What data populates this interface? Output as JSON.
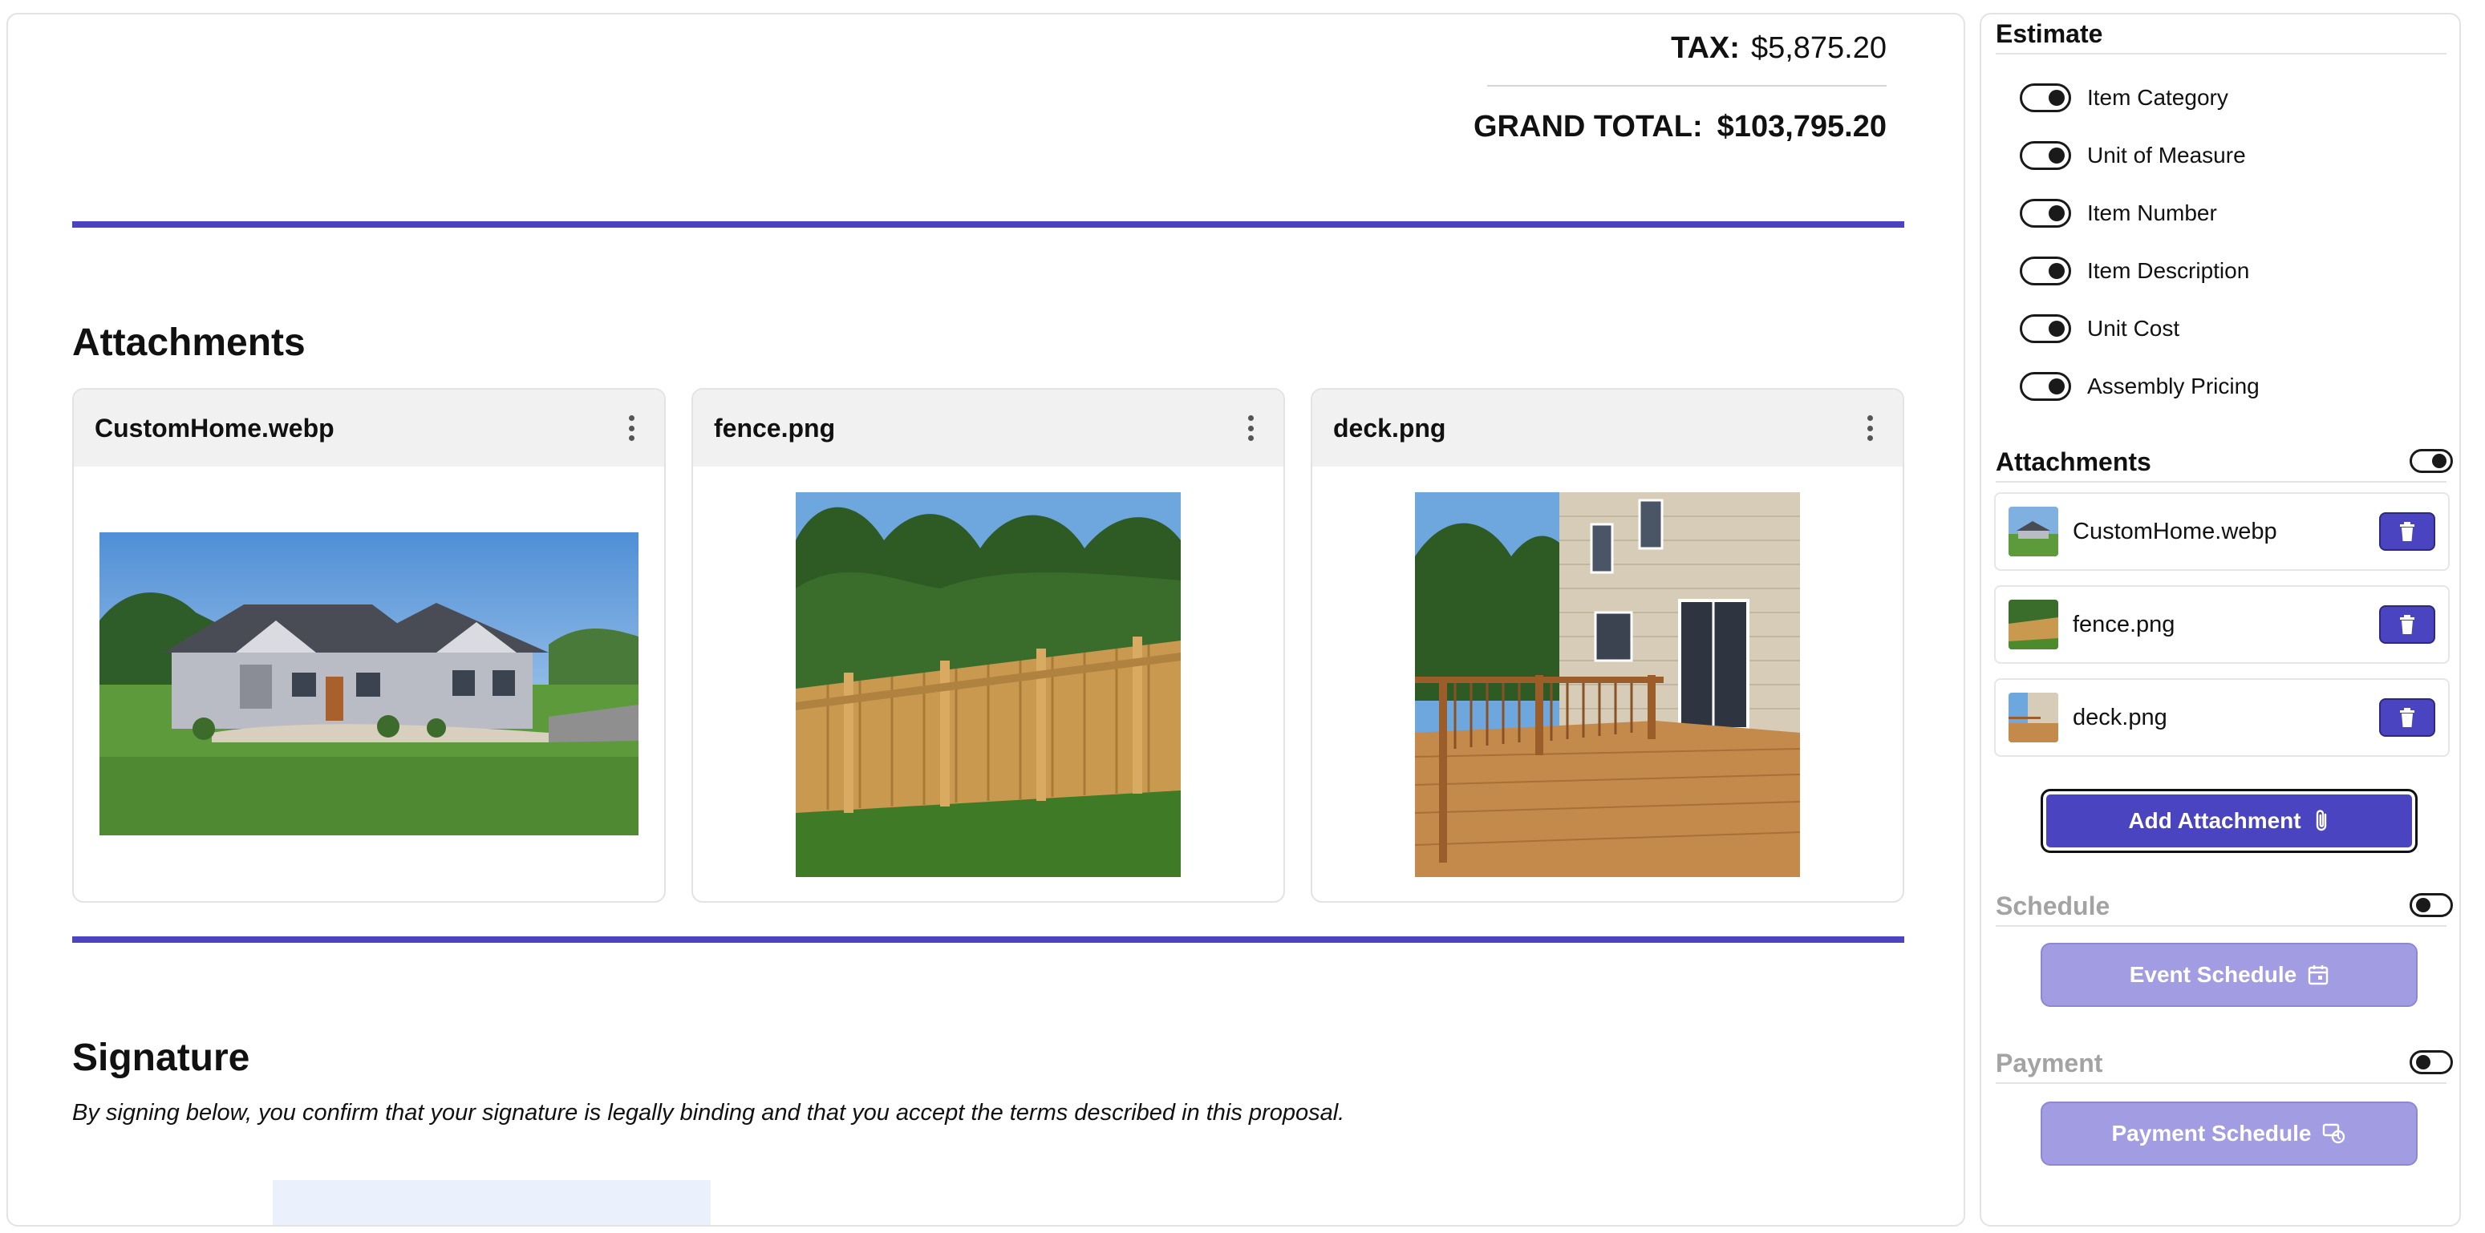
{
  "totals": {
    "tax_label": "TAX:",
    "tax_value": "$5,875.20",
    "grand_label": "GRAND TOTAL:",
    "grand_value": "$103,795.20"
  },
  "attachments_section": {
    "title": "Attachments",
    "cards": [
      {
        "title": "CustomHome.webp",
        "menu_icon": "kebab-icon"
      },
      {
        "title": "fence.png",
        "menu_icon": "kebab-icon"
      },
      {
        "title": "deck.png",
        "menu_icon": "kebab-icon"
      }
    ]
  },
  "signature_section": {
    "title": "Signature",
    "text": "By signing below, you confirm that your signature is legally binding and that you accept the terms described in this proposal."
  },
  "sidebar": {
    "estimate": {
      "title": "Estimate",
      "options": [
        {
          "label": "Item Category",
          "on": true
        },
        {
          "label": "Unit of Measure",
          "on": true
        },
        {
          "label": "Item Number",
          "on": true
        },
        {
          "label": "Item Description",
          "on": true
        },
        {
          "label": "Unit Cost",
          "on": true
        },
        {
          "label": "Assembly Pricing",
          "on": true
        }
      ]
    },
    "attachments": {
      "title": "Attachments",
      "enabled": true,
      "items": [
        {
          "name": "CustomHome.webp"
        },
        {
          "name": "fence.png"
        },
        {
          "name": "deck.png"
        }
      ],
      "add_button": "Add Attachment"
    },
    "schedule": {
      "title": "Schedule",
      "enabled": false,
      "button": "Event Schedule"
    },
    "payment": {
      "title": "Payment",
      "enabled": false,
      "button": "Payment Schedule"
    }
  },
  "colors": {
    "accent": "#4b44c0",
    "accent_disabled": "#a29de3",
    "signature_box": "#eaf0fc"
  }
}
